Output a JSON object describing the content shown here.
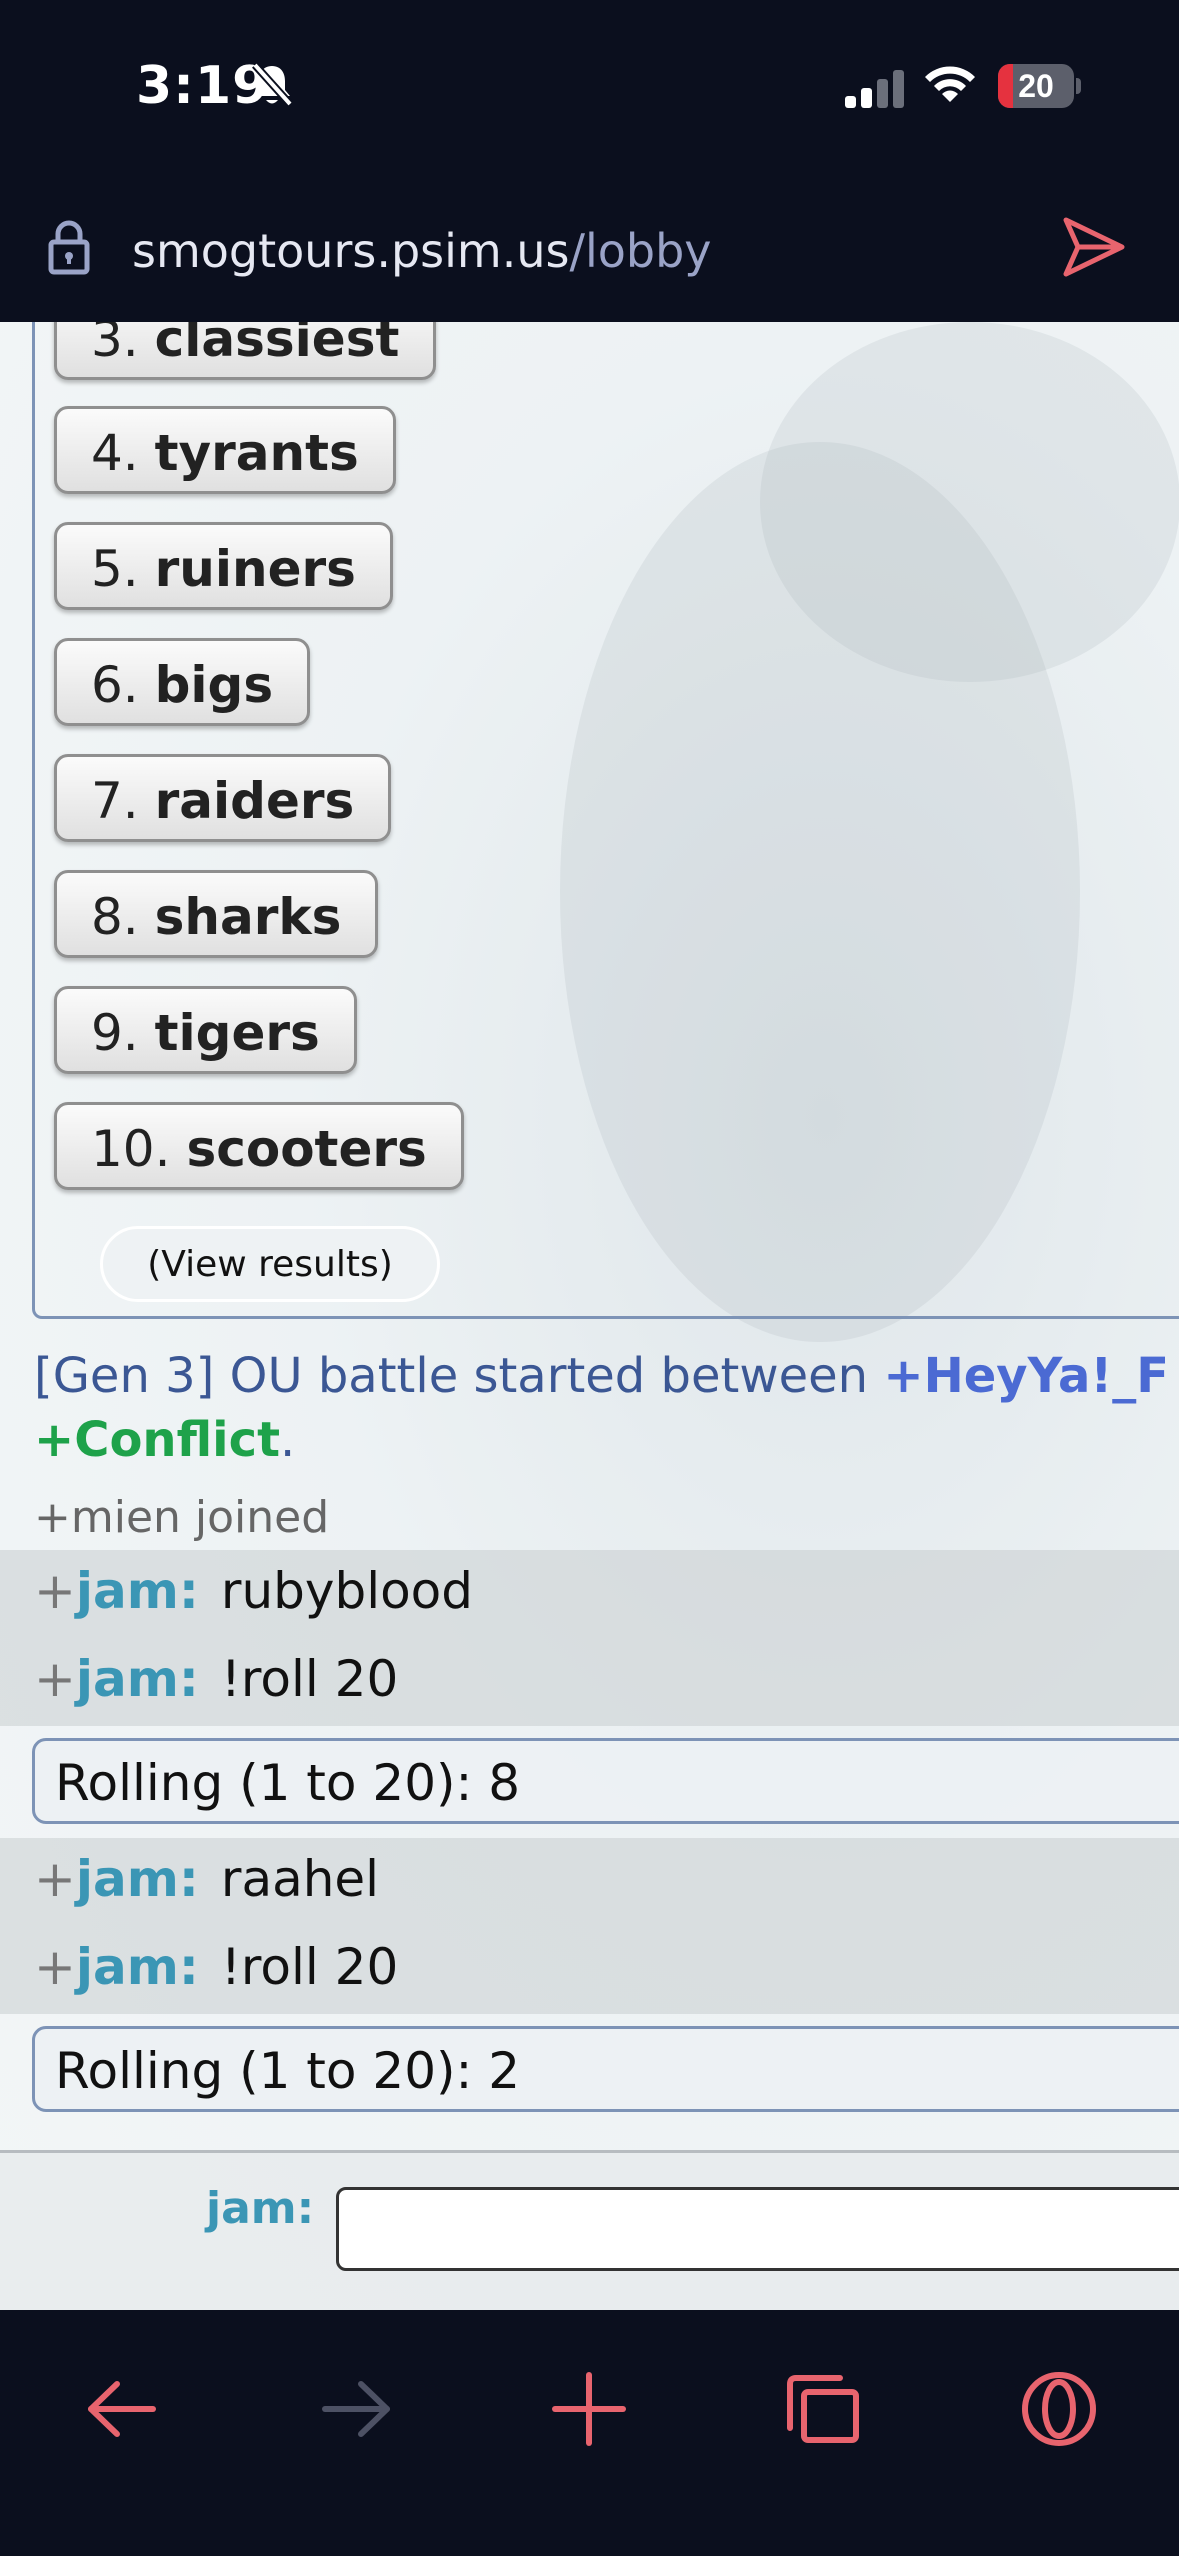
{
  "status": {
    "time": "3:19",
    "battery": "20",
    "battery_level": 0.2
  },
  "browser": {
    "url_host": "smogtours.psim.us",
    "url_path": "/lobby"
  },
  "poll": {
    "options": [
      {
        "num": "3.",
        "name": "classiest"
      },
      {
        "num": "4.",
        "name": "tyrants"
      },
      {
        "num": "5.",
        "name": "ruiners"
      },
      {
        "num": "6.",
        "name": "bigs"
      },
      {
        "num": "7.",
        "name": "raiders"
      },
      {
        "num": "8.",
        "name": "sharks"
      },
      {
        "num": "9.",
        "name": "tigers"
      },
      {
        "num": "10.",
        "name": "scooters"
      }
    ],
    "view_results": "(View results)"
  },
  "battle": {
    "prefix": "[Gen 3] OU battle started between ",
    "user1": "+HeyYa!_F",
    "user2": "+Conflict",
    "suffix": "."
  },
  "joined": "+mien joined",
  "chat": [
    {
      "rank": "+",
      "user": "jam:",
      "message": "rubyblood"
    },
    {
      "rank": "+",
      "user": "jam:",
      "message": "!roll 20"
    },
    {
      "roll": "Rolling (1 to 20): 8"
    },
    {
      "rank": "+",
      "user": "jam:",
      "message": "raahel"
    },
    {
      "rank": "+",
      "user": "jam:",
      "message": "!roll 20"
    },
    {
      "roll": "Rolling (1 to 20): 2"
    }
  ],
  "input": {
    "label": "jam:",
    "value": ""
  },
  "toolbar": {
    "icons": [
      "back-icon",
      "forward-icon",
      "new-tab-icon",
      "tabs-icon",
      "opera-menu-icon"
    ]
  },
  "colors": {
    "accent": "#e8646e",
    "chrome": "#0b0f1e",
    "username": "#3b96b5",
    "battle_text": "#3b5794"
  }
}
